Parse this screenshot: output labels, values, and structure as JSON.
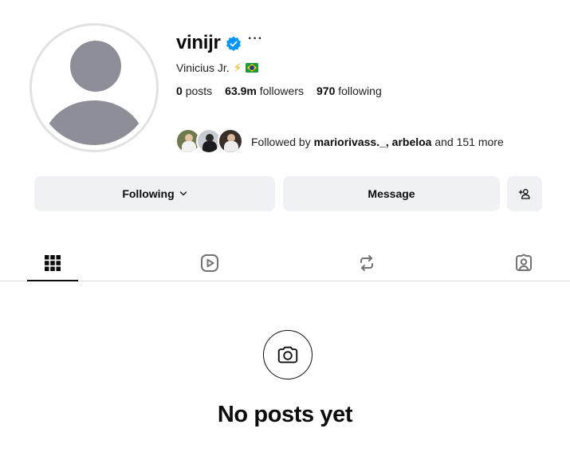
{
  "profile": {
    "username": "vinijr",
    "verified": true,
    "more_glyph": "···",
    "full_name": "Vinicius Jr.",
    "emoji_bolt": "⚡",
    "flag": "brazil-flag",
    "stats": {
      "posts_count": "0",
      "posts_label": "posts",
      "followers_count": "63.9m",
      "followers_label": "followers",
      "following_count": "970",
      "following_label": "following"
    },
    "followed_by": {
      "prefix": "Followed by",
      "names": "mariorivass._, arbeloa",
      "suffix": "and 151 more"
    }
  },
  "actions": {
    "following_label": "Following",
    "message_label": "Message",
    "add_icon": "add-person-icon"
  },
  "tabs": [
    {
      "name": "posts",
      "icon": "grid-icon",
      "active": true
    },
    {
      "name": "reels",
      "icon": "reels-icon",
      "active": false
    },
    {
      "name": "reposts",
      "icon": "repost-icon",
      "active": false
    },
    {
      "name": "tagged",
      "icon": "tagged-icon",
      "active": false
    }
  ],
  "empty_state": {
    "icon": "camera-icon",
    "title": "No posts yet"
  },
  "colors": {
    "verified_blue": "#0095f6",
    "button_bg": "#eff1f4",
    "avatar_gray": "#8e8e99"
  }
}
